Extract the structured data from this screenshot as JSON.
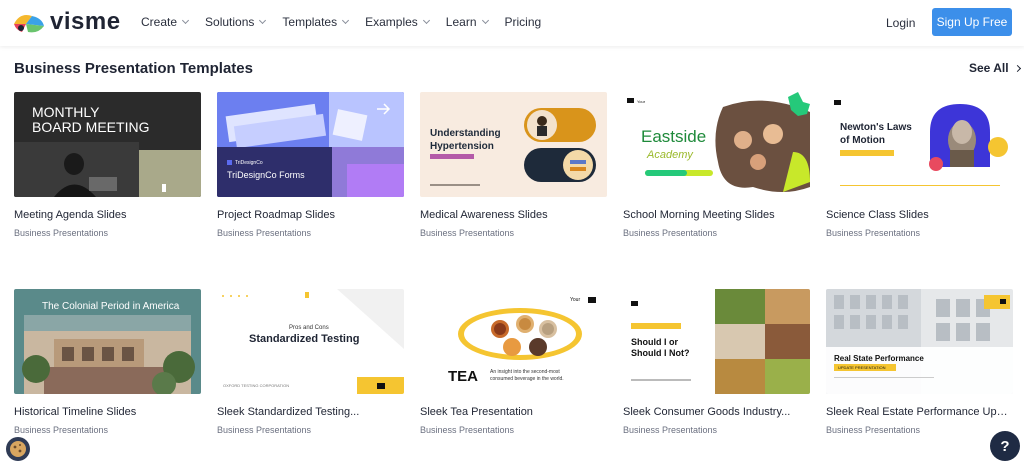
{
  "brand": {
    "name": "visme",
    "accent": "#3c8fea"
  },
  "nav": {
    "items": [
      {
        "label": "Create",
        "has_dropdown": true
      },
      {
        "label": "Solutions",
        "has_dropdown": true
      },
      {
        "label": "Templates",
        "has_dropdown": true
      },
      {
        "label": "Examples",
        "has_dropdown": true
      },
      {
        "label": "Learn",
        "has_dropdown": true
      },
      {
        "label": "Pricing",
        "has_dropdown": false
      }
    ],
    "login": "Login",
    "signup": "Sign Up Free"
  },
  "section": {
    "title": "Business Presentation Templates",
    "see_all": "See All"
  },
  "cards": [
    {
      "title": "Meeting Agenda Slides",
      "category": "Business Presentations",
      "thumb_text": [
        "MONTHLY",
        "BOARD MEETING"
      ]
    },
    {
      "title": "Project Roadmap Slides",
      "category": "Business Presentations",
      "thumb_text": [
        "TriDesignCo Forms",
        "TriDesignCo"
      ]
    },
    {
      "title": "Medical Awareness Slides",
      "category": "Business Presentations",
      "thumb_text": [
        "Understanding",
        "Hypertension"
      ]
    },
    {
      "title": "School Morning Meeting Slides",
      "category": "Business Presentations",
      "thumb_text": [
        "Eastside",
        "Academy"
      ]
    },
    {
      "title": "Science Class Slides",
      "category": "Business Presentations",
      "thumb_text": [
        "Newton's Laws",
        "of Motion"
      ]
    },
    {
      "title": "Historical Timeline Slides",
      "category": "Business Presentations",
      "thumb_text": [
        "The Colonial Period in America"
      ]
    },
    {
      "title": "Sleek Standardized Testing...",
      "category": "Business Presentations",
      "thumb_text": [
        "Pros and Cons",
        "Standardized Testing",
        "OXFORD TESTING CORPORATION"
      ]
    },
    {
      "title": "Sleek Tea Presentation",
      "category": "Business Presentations",
      "thumb_text": [
        "TEA",
        "An insight into the second-most",
        "consumed beverage in the world."
      ]
    },
    {
      "title": "Sleek Consumer Goods Industry...",
      "category": "Business Presentations",
      "thumb_text": [
        "Should I or",
        "Should I Not?"
      ]
    },
    {
      "title": "Sleek Real Estate Performance Upda...",
      "category": "Business Presentations",
      "thumb_text": [
        "Real State Performance",
        "UPDATE PRESENTATION"
      ]
    }
  ],
  "help": {
    "label": "?"
  }
}
